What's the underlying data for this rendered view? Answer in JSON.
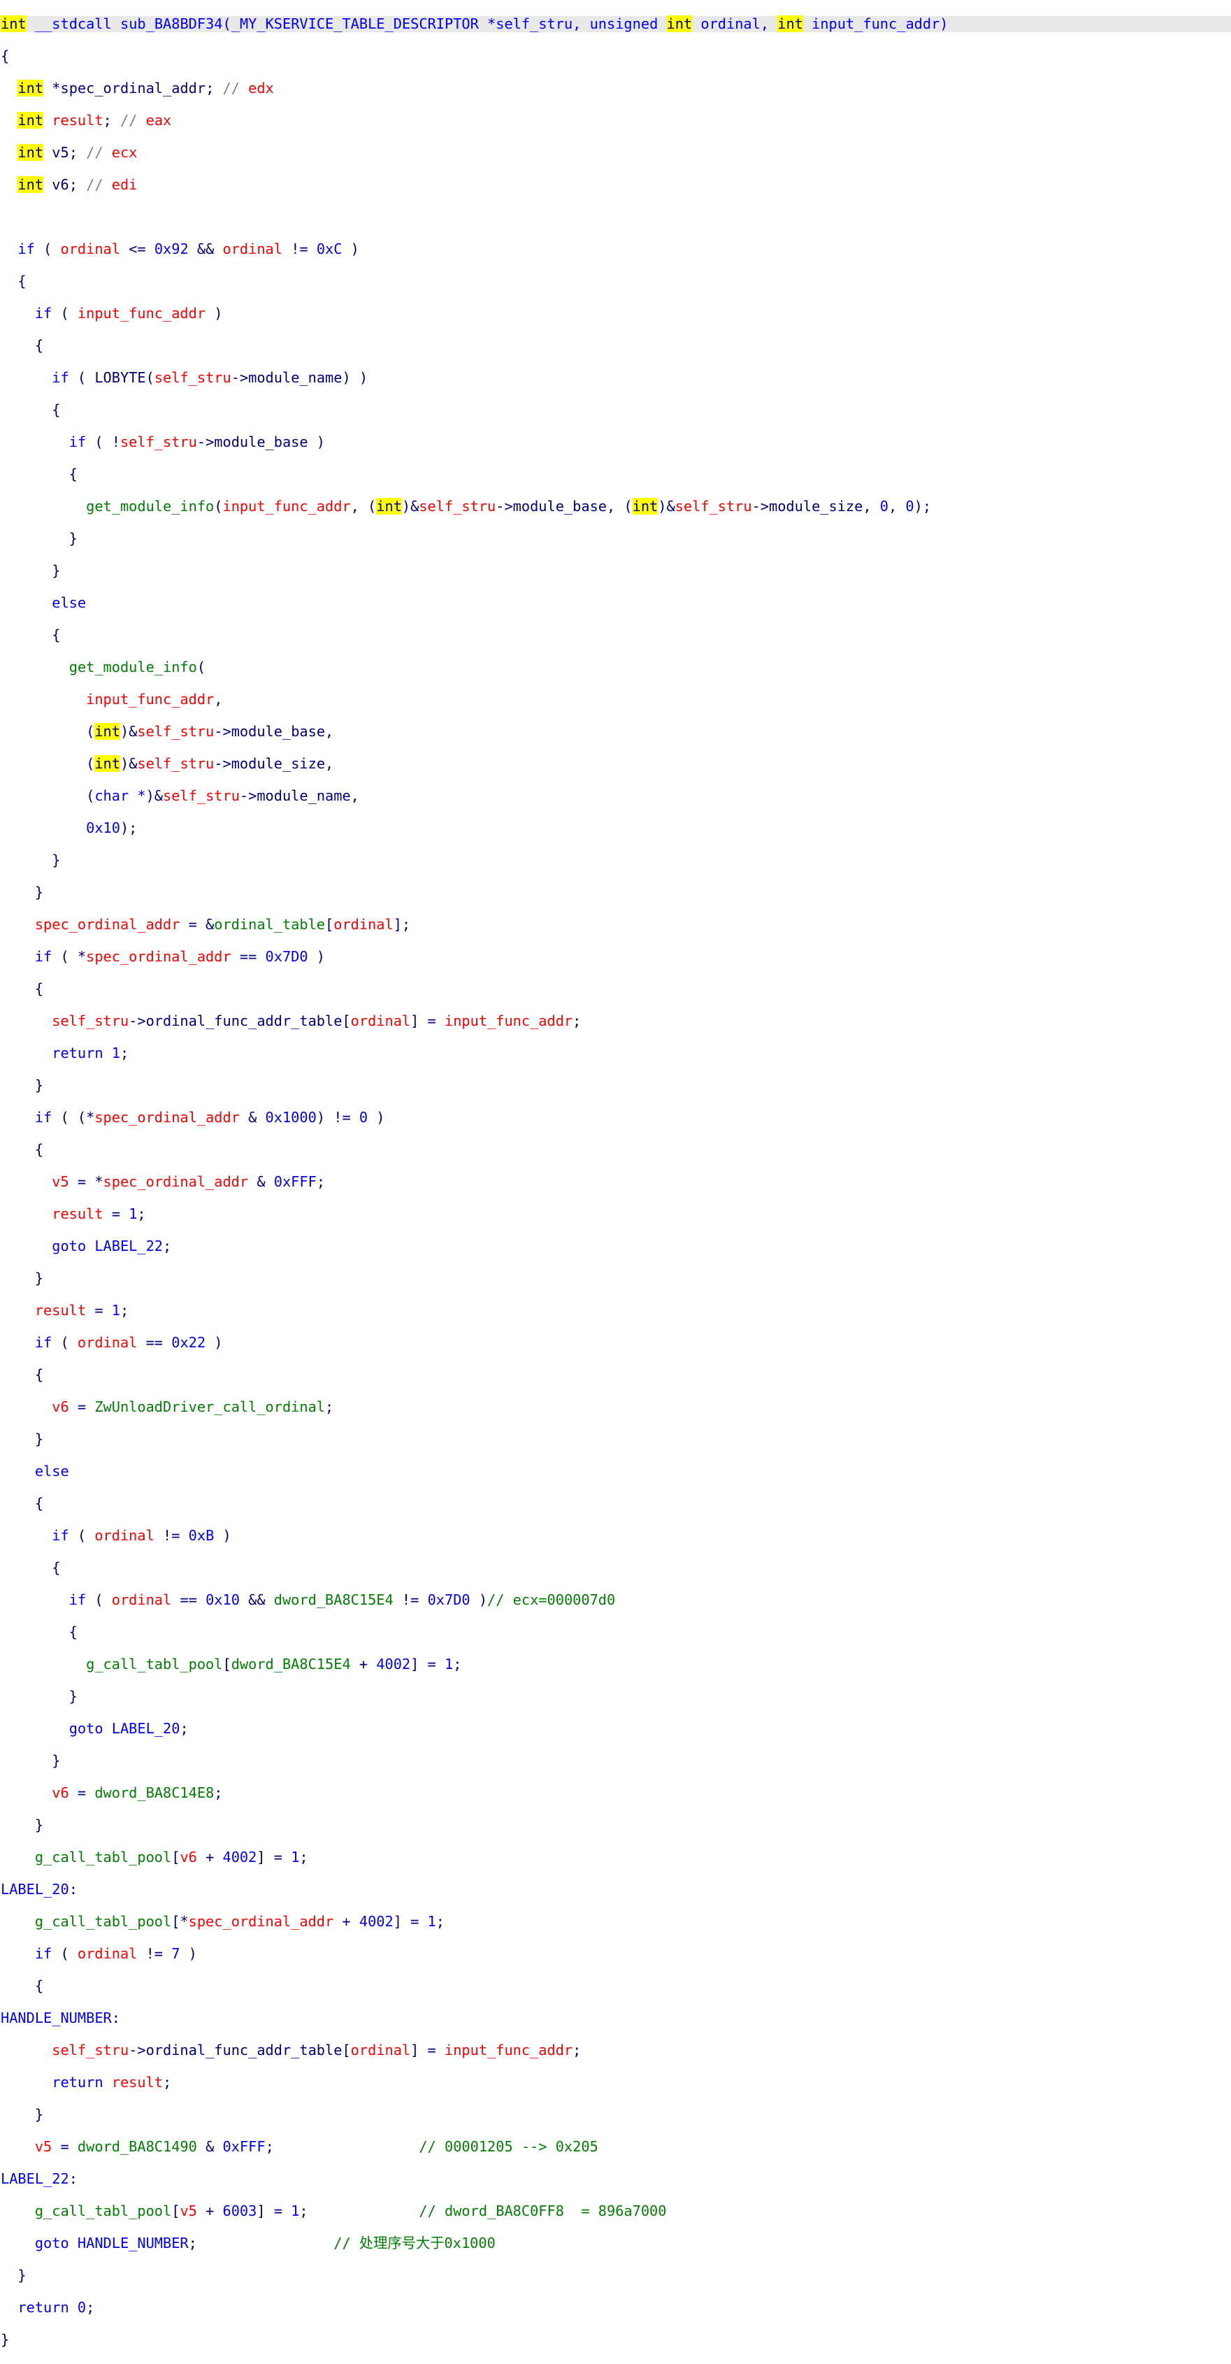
{
  "function": {
    "ret_type": "int",
    "calling_conv": "__stdcall",
    "name": "sub_BA8BDF34",
    "param1_type": "_MY_KSERVICE_TABLE_DESCRIPTOR",
    "param1_name": "self_stru",
    "param2_type_a": "unsigned",
    "param2_type_b": "int",
    "param2_name": "ordinal",
    "param3_type": "int",
    "param3_name": "input_func_addr"
  },
  "locals": [
    {
      "type": "int",
      "name": "*spec_ordinal_addr",
      "reg": "edx"
    },
    {
      "type": "int",
      "name": "result",
      "reg": "eax"
    },
    {
      "type": "int",
      "name": "v5",
      "reg": "ecx"
    },
    {
      "type": "int",
      "name": "v6",
      "reg": "edi"
    }
  ],
  "comments": {
    "c1": "// ecx=000007d0",
    "c2": "// 00001205 --> 0x205",
    "c3": "// dword_BA8C0FF8  = 896a7000",
    "c4": "// 处理序号大于0x1000"
  },
  "labels": {
    "l20": "LABEL_20",
    "handle": "HANDLE_NUMBER",
    "l22": "LABEL_22"
  },
  "globals": {
    "g1": "dword_BA8C15E4",
    "g2": "dword_BA8C14E8",
    "g3": "dword_BA8C1490",
    "table": "ordinal_table",
    "pool": "g_call_tabl_pool",
    "unload": "ZwUnloadDriver_call_ordinal"
  }
}
